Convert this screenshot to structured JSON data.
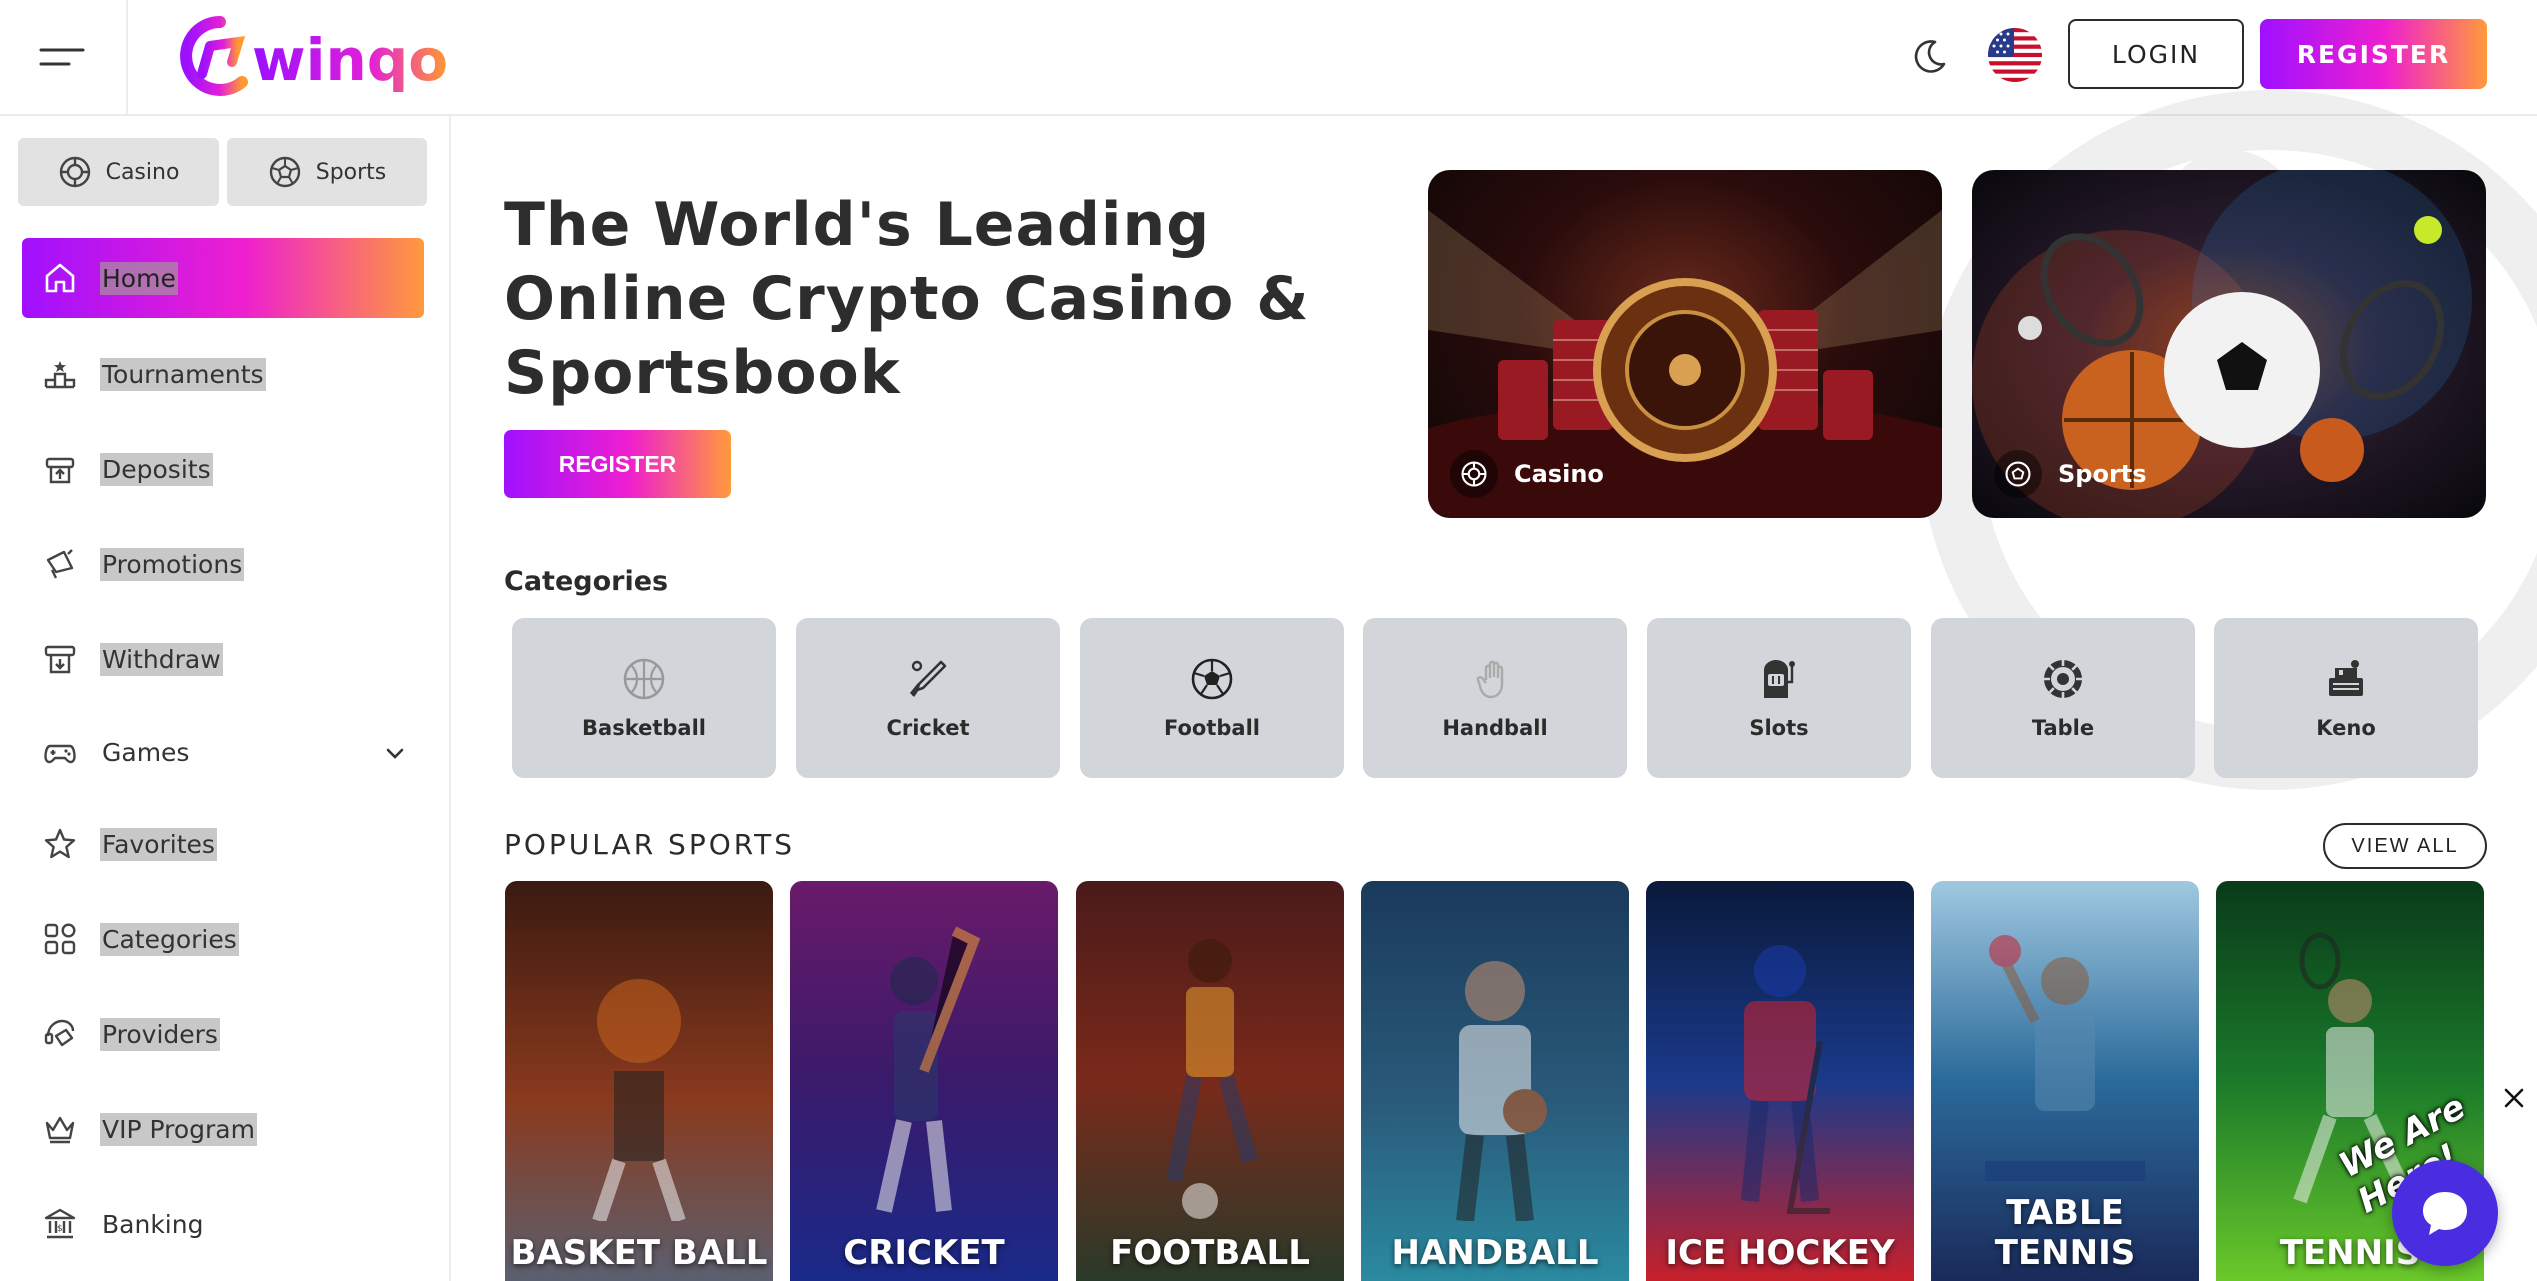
{
  "header": {
    "brand": "winqo",
    "login_label": "LOGIN",
    "register_label": "REGISTER"
  },
  "sidebar": {
    "switch": [
      {
        "label": "Casino",
        "icon": "casino-chip-icon"
      },
      {
        "label": "Sports",
        "icon": "soccer-ball-icon"
      }
    ],
    "items": [
      {
        "label": "Home",
        "icon": "home-icon"
      },
      {
        "label": "Tournaments",
        "icon": "podium-icon"
      },
      {
        "label": "Deposits",
        "icon": "deposit-icon"
      },
      {
        "label": "Promotions",
        "icon": "megaphone-icon"
      },
      {
        "label": "Withdraw",
        "icon": "withdraw-icon"
      },
      {
        "label": "Games",
        "icon": "gamepad-icon"
      },
      {
        "label": "Favorites",
        "icon": "star-icon"
      },
      {
        "label": "Categories",
        "icon": "grid-icon"
      },
      {
        "label": "Providers",
        "icon": "providers-icon"
      },
      {
        "label": "VIP Program",
        "icon": "crown-icon"
      },
      {
        "label": "Banking",
        "icon": "bank-icon"
      }
    ]
  },
  "hero": {
    "title_line1": "The World's Leading",
    "title_line2": "Online Crypto Casino &",
    "title_line3": "Sportsbook",
    "register_label": "REGISTER",
    "promos": [
      {
        "label": "Casino"
      },
      {
        "label": "Sports"
      }
    ]
  },
  "categories": {
    "title": "Categories",
    "items": [
      {
        "label": "Basketball",
        "icon": "basketball-icon"
      },
      {
        "label": "Cricket",
        "icon": "cricket-bat-icon"
      },
      {
        "label": "Football",
        "icon": "football-icon"
      },
      {
        "label": "Handball",
        "icon": "hand-icon"
      },
      {
        "label": "Slots",
        "icon": "slot-machine-icon"
      },
      {
        "label": "Table",
        "icon": "roulette-table-icon"
      },
      {
        "label": "Keno",
        "icon": "keno-machine-icon"
      }
    ]
  },
  "popular": {
    "title": "POPULAR SPORTS",
    "view_all": "VIEW ALL",
    "cards": [
      {
        "label": "BASKET BALL",
        "color": "#8a3a1e"
      },
      {
        "label": "CRICKET",
        "color": "#3a1a6a"
      },
      {
        "label": "FOOTBALL",
        "color": "#7a2a1a"
      },
      {
        "label": "HANDBALL",
        "color": "#2a5a7a"
      },
      {
        "label": "ICE HOCKEY",
        "color": "#1a3a8a"
      },
      {
        "label": "TABLE TENNIS",
        "color": "#2a6a9a"
      },
      {
        "label": "TENNIS",
        "color": "#1a7a2a"
      }
    ]
  },
  "chat": {
    "bubble_text": "We Are Here!"
  },
  "colors": {
    "accent_start": "#a010ff",
    "accent_mid": "#ee1fd0",
    "accent_end": "#ff9a3c"
  }
}
